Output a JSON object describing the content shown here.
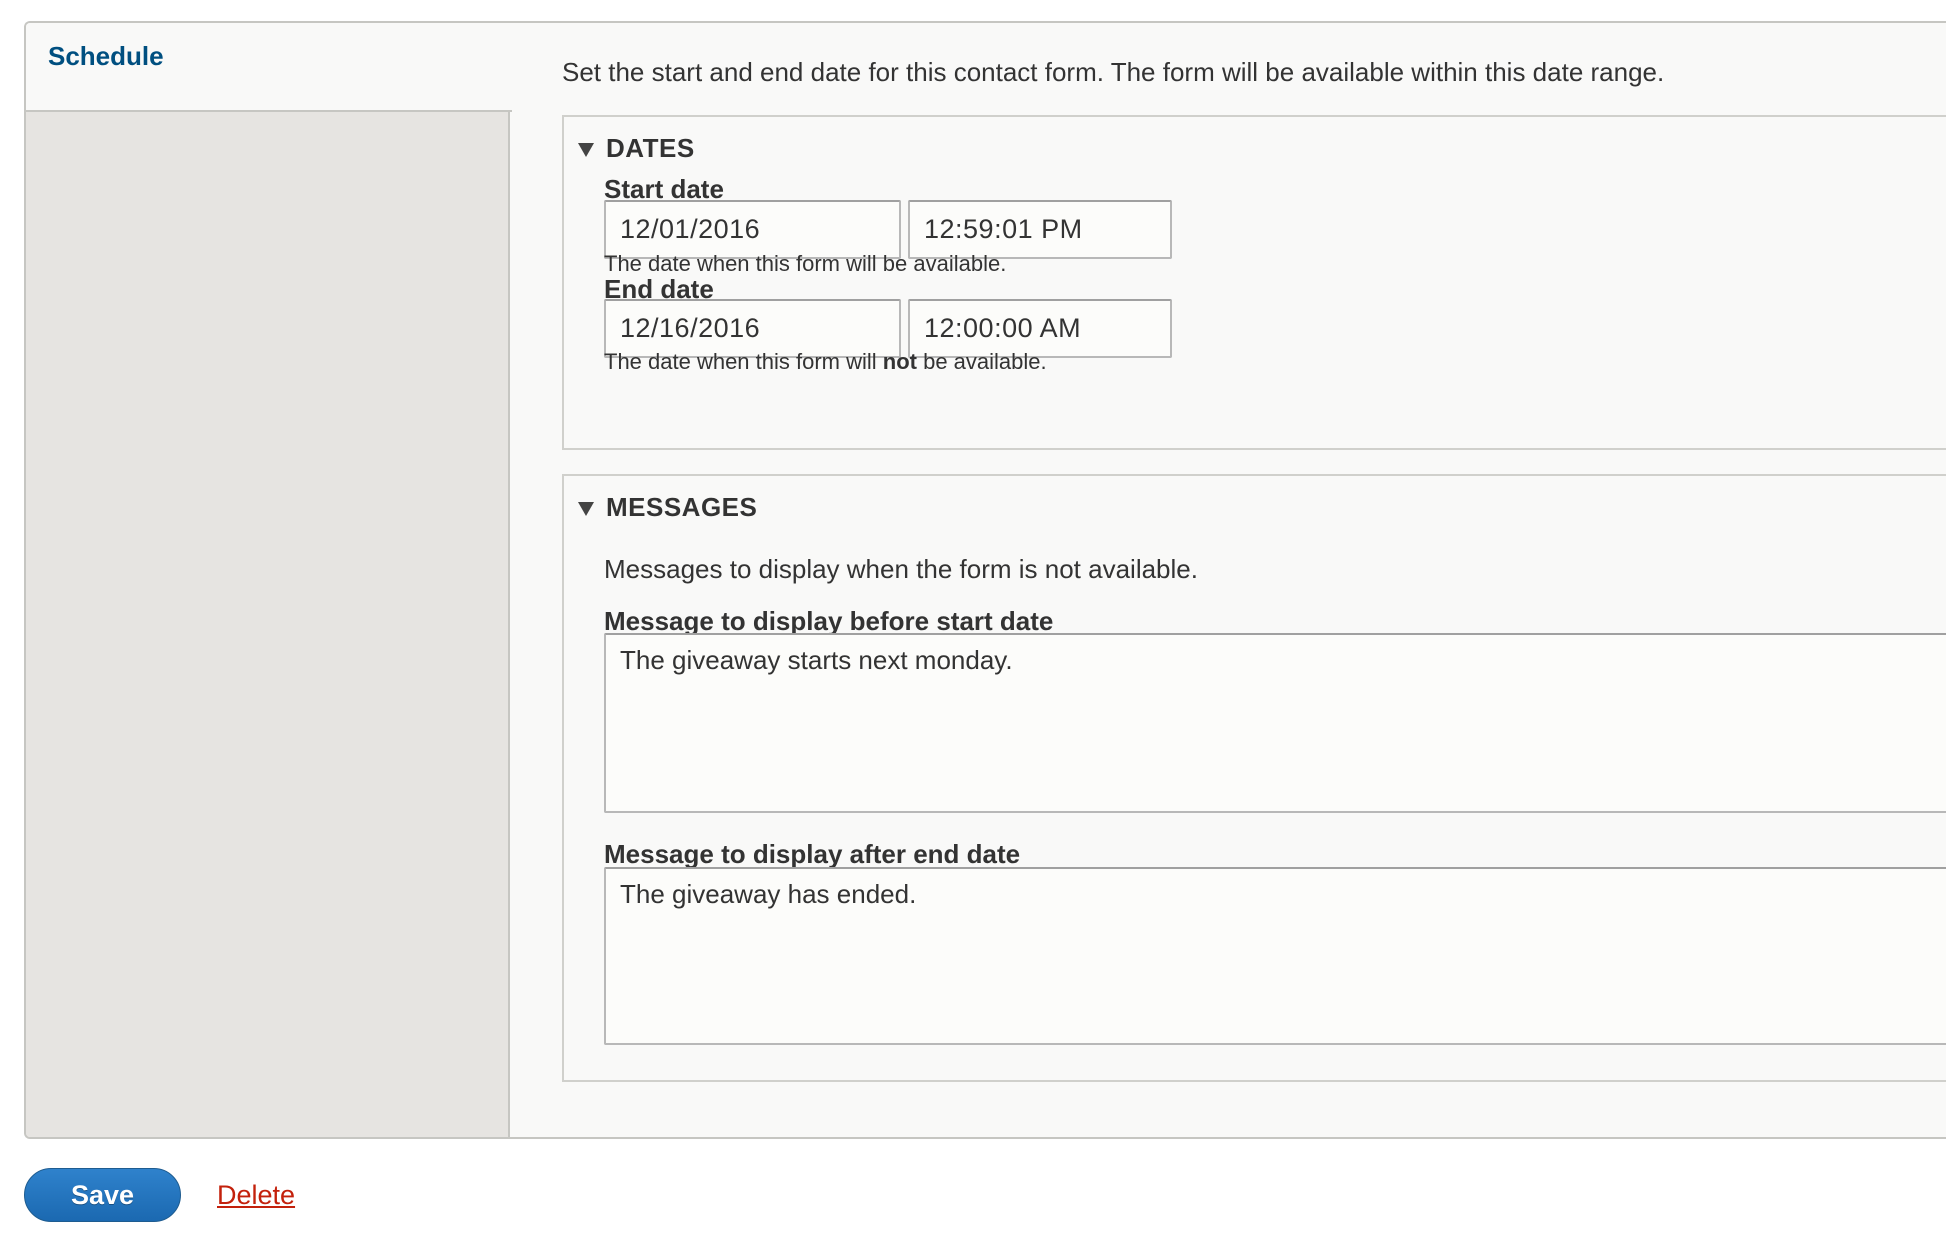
{
  "vertical_tabs": {
    "active": {
      "title": "Schedule"
    }
  },
  "schedule": {
    "description": "Set the start and end date for this contact form. The form will be available within this date range.",
    "dates": {
      "legend": "DATES",
      "start": {
        "label": "Start date",
        "date_value": "12/01/2016",
        "time_value": "12:59:01 PM",
        "description": "The date when this form will be available."
      },
      "end": {
        "label": "End date",
        "date_value": "12/16/2016",
        "time_value": "12:00:00 AM",
        "description_prefix": "The date when this form will ",
        "description_emphasis": "not",
        "description_suffix": " be available."
      }
    },
    "messages": {
      "legend": "MESSAGES",
      "description": "Messages to display when the form is not available.",
      "before": {
        "label": "Message to display before start date",
        "value": "The giveaway starts next monday."
      },
      "after": {
        "label": "Message to display after end date",
        "value": "The giveaway has ended."
      }
    }
  },
  "actions": {
    "save_label": "Save",
    "delete_label": "Delete"
  },
  "colors": {
    "tab_title": "#004f80",
    "save_button": "#1b69b1",
    "delete_link": "#c3210c"
  },
  "icons": {
    "legend_toggle": "triangle-down-icon"
  }
}
